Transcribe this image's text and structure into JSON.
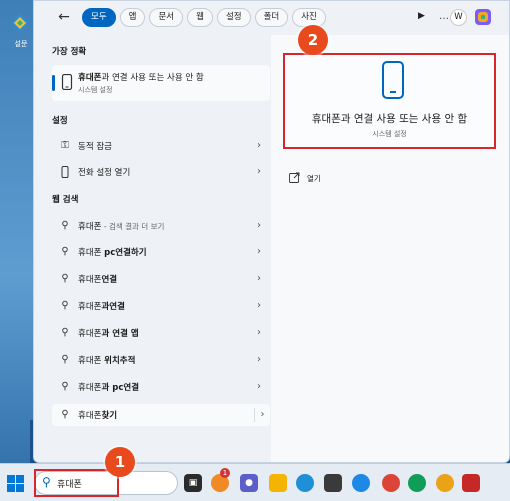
{
  "desktop": {
    "icon_label": "설문"
  },
  "topbar": {
    "tabs": [
      "모두",
      "앱",
      "문서",
      "웹",
      "설정",
      "폴더",
      "사진"
    ],
    "active_tab": "모두",
    "user_initial": "W"
  },
  "left": {
    "best_match_header": "가장 정확",
    "best_match": {
      "title_bold": "휴대폰",
      "title_rest": "과 연결 사용 또는 사용 안 함",
      "subtitle": "시스템 설정"
    },
    "settings_header": "설정",
    "settings": [
      {
        "label": "동적 잠금",
        "icon": "key-icon"
      },
      {
        "label": "전화 설정 열기",
        "icon": "phone-icon"
      }
    ],
    "web_header": "웹 검색",
    "web": [
      {
        "label": "휴대폰",
        "hint": " - 검색 결과 더 보기"
      },
      {
        "label_a": "휴대폰 ",
        "label_b": "pc연결하기"
      },
      {
        "label_a": "휴대폰",
        "label_b": "연결"
      },
      {
        "label_a": "휴대폰",
        "label_b": "과연결"
      },
      {
        "label_a": "휴대폰",
        "label_b": "과 연결 앱"
      },
      {
        "label_a": "휴대폰 ",
        "label_b": "위치추적"
      },
      {
        "label_a": "휴대폰",
        "label_b": "과 pc연결"
      },
      {
        "label_a": "휴대폰",
        "label_b": "찾기"
      }
    ]
  },
  "right": {
    "title": "휴대폰과 연결 사용 또는 사용 안 함",
    "subtitle": "시스템 설정",
    "open_label": "열기"
  },
  "taskbar": {
    "search_value": "휴대폰",
    "notification_count": "1"
  },
  "callouts": {
    "one": "1",
    "two": "2"
  },
  "colors": {
    "accent": "#0067c0",
    "highlight": "#d7262e",
    "callout": "#e8491d"
  }
}
